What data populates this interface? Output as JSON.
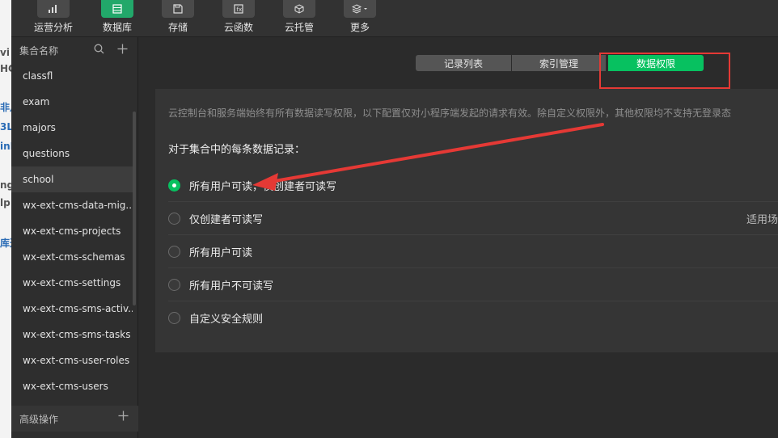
{
  "background_page": {
    "fragments": [
      "vi",
      "HC",
      "非月",
      "3L",
      "inF",
      "ng",
      "lp",
      "库达"
    ]
  },
  "toolbar": {
    "items": [
      {
        "label": "运营分析",
        "icon": "bar-chart-icon"
      },
      {
        "label": "数据库",
        "icon": "database-icon",
        "active": true
      },
      {
        "label": "存储",
        "icon": "storage-icon"
      },
      {
        "label": "云函数",
        "icon": "function-icon"
      },
      {
        "label": "云托管",
        "icon": "cube-icon"
      },
      {
        "label": "更多",
        "icon": "layers-icon"
      }
    ]
  },
  "sidebar": {
    "header": "集合名称",
    "collections": [
      "classfl",
      "exam",
      "majors",
      "questions",
      "school",
      "wx-ext-cms-data-mig...",
      "wx-ext-cms-projects",
      "wx-ext-cms-schemas",
      "wx-ext-cms-settings",
      "wx-ext-cms-sms-activ...",
      "wx-ext-cms-sms-tasks",
      "wx-ext-cms-user-roles",
      "wx-ext-cms-users"
    ],
    "selected_collection": "school",
    "footer": "高级操作"
  },
  "tabs": {
    "records": "记录列表",
    "index": "索引管理",
    "permissions": "数据权限",
    "active": "数据权限"
  },
  "panel": {
    "notice": "云控制台和服务端始终有所有数据读写权限，以下配置仅对小程序端发起的请求有效。除自定义权限外，其他权限均不支持无登录态",
    "section_title": "对于集合中的每条数据记录：",
    "options": [
      {
        "label": "所有用户可读，仅创建者可读写",
        "checked": true,
        "extra": ""
      },
      {
        "label": "仅创建者可读写",
        "checked": false,
        "extra": "适用场"
      },
      {
        "label": "所有用户可读",
        "checked": false,
        "extra": ""
      },
      {
        "label": "所有用户不可读写",
        "checked": false,
        "extra": ""
      },
      {
        "label": "自定义安全规则",
        "checked": false,
        "extra": ""
      }
    ]
  },
  "colors": {
    "accent": "#07c160",
    "annotation": "#e53935"
  }
}
